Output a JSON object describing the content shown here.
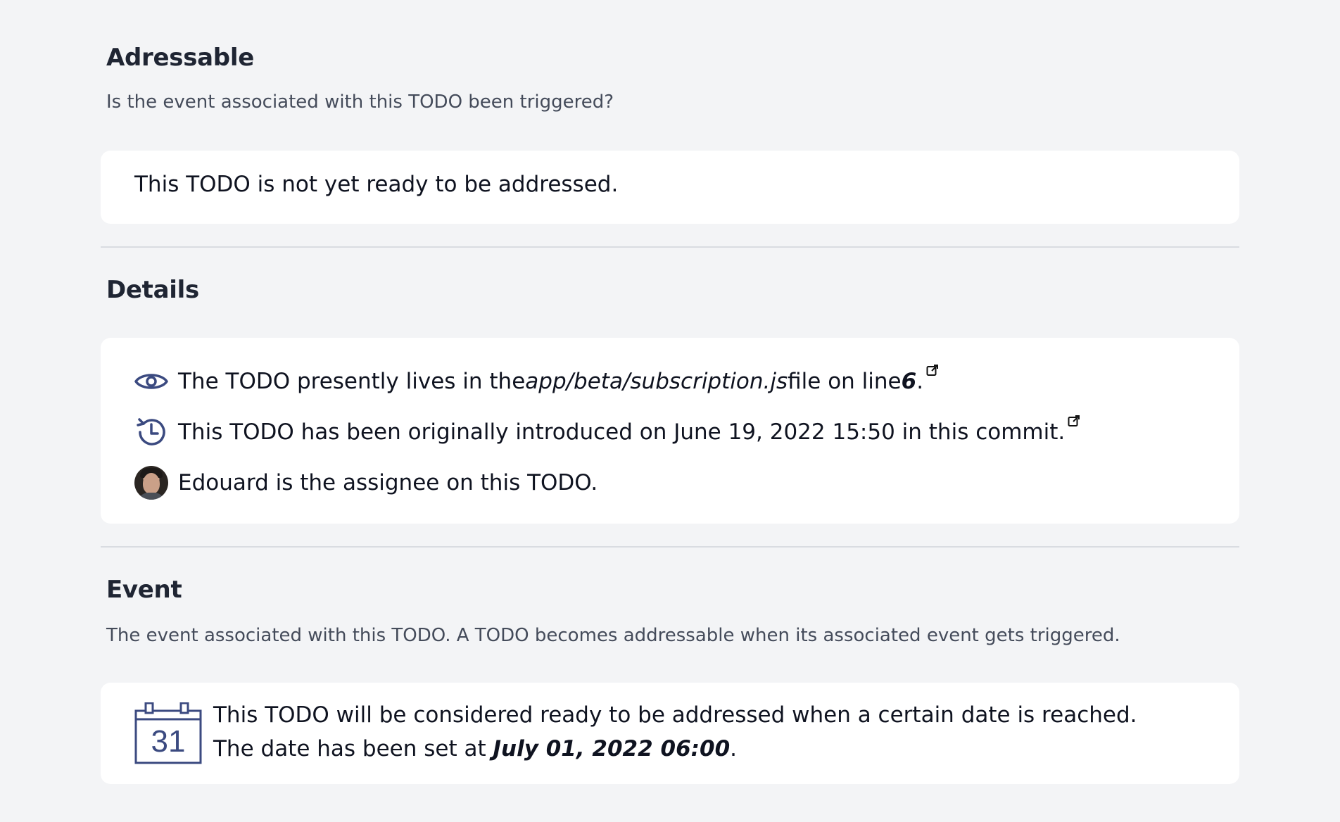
{
  "addressable": {
    "title": "Adressable",
    "description": "Is the event associated with this TODO been triggered?",
    "status": "This TODO is not yet ready to be addressed."
  },
  "details": {
    "title": "Details",
    "location": {
      "prefix": "The TODO presently lives in the ",
      "file": "app/beta/subscription.js",
      "middle": " file on line ",
      "line": "6",
      "suffix": "."
    },
    "history": {
      "text": "This TODO has been originally introduced on June 19, 2022 15:50 in this commit."
    },
    "assignee": {
      "text": "Edouard is the assignee on this TODO."
    }
  },
  "event": {
    "title": "Event",
    "description": "The event associated with this TODO. A TODO becomes addressable when its associated event gets triggered.",
    "line1": "This TODO will be considered ready to be addressed when a certain date is reached.",
    "line2_prefix": "The date has been set at ",
    "date": "July 01, 2022 06:00",
    "line2_suffix": ".",
    "calendar_day": "31"
  },
  "colors": {
    "icon": "#3b4a80",
    "background": "#f3f4f6",
    "card": "#ffffff"
  },
  "icons": {
    "location": "eye-icon",
    "history": "history-clock-icon",
    "external": "external-link-icon",
    "event": "calendar-icon"
  }
}
